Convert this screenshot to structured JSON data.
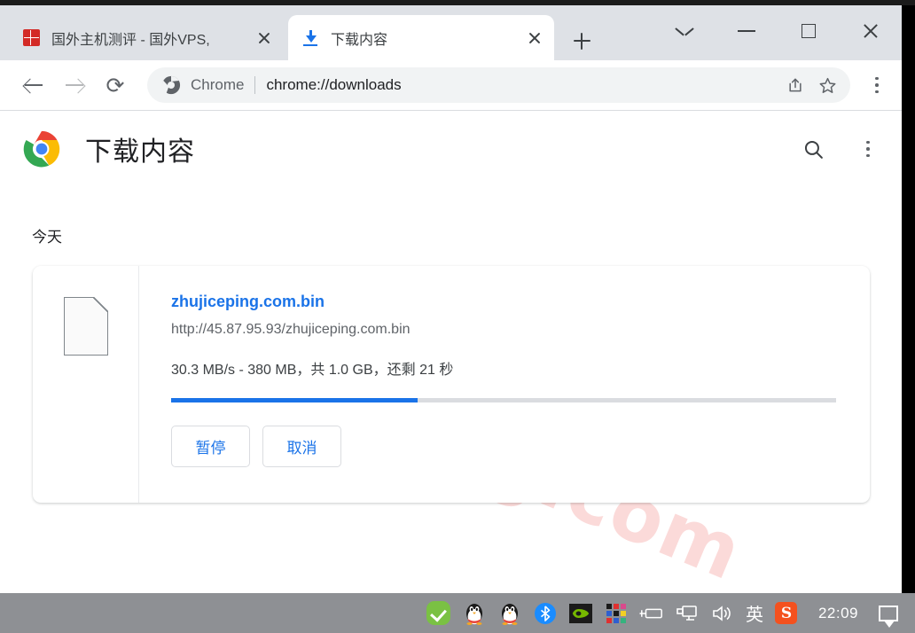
{
  "window": {
    "controls": {
      "tab_search": "tab-search",
      "minimize": "minimize",
      "maximize": "maximize",
      "close": "close"
    }
  },
  "tabs": [
    {
      "title": "国外主机测评 - 国外VPS,",
      "favicon": "red-site-favicon",
      "active": false,
      "close_label": "×"
    },
    {
      "title": "下载内容",
      "favicon": "download-icon",
      "active": true,
      "close_label": "×"
    }
  ],
  "new_tab_label": "+",
  "toolbar": {
    "back": "back-arrow",
    "forward": "forward-arrow",
    "reload": "⟳",
    "omnibox": {
      "brand": "Chrome",
      "url": "chrome://downloads",
      "share_icon": "share-icon",
      "bookmark_icon": "star-icon"
    },
    "menu": "chrome-menu"
  },
  "page": {
    "title": "下载内容",
    "search_icon": "search-icon",
    "more_icon": "more-vert-icon",
    "watermark": "zhujiceping.com",
    "section_date": "今天",
    "download": {
      "file_icon": "generic-file-icon",
      "filename": "zhujiceping.com.bin",
      "url": "http://45.87.95.93/zhujiceping.com.bin",
      "status": "30.3 MB/s - 380 MB，共 1.0 GB，还剩 21 秒",
      "progress_percent": 37,
      "speed": "30.3 MB/s",
      "downloaded": "380 MB",
      "total": "1.0 GB",
      "time_left": "还剩 21 秒",
      "pause_label": "暂停",
      "cancel_label": "取消"
    }
  },
  "taskbar": {
    "icons": [
      "shield-check-icon",
      "qq-penguin-icon",
      "qq-penguin-icon",
      "bluetooth-icon",
      "nvidia-icon",
      "color-grid-icon",
      "battery-icon",
      "display-icon",
      "volume-icon"
    ],
    "ime": "英",
    "sogou": "S",
    "clock": "22:09",
    "notification": "notification-icon"
  },
  "colors": {
    "accent": "#1a73e8",
    "tabstrip_bg": "#dee1e6",
    "taskbar_bg": "#8e9094",
    "watermark": "#fbdad9",
    "progress_track": "#dadce0"
  }
}
